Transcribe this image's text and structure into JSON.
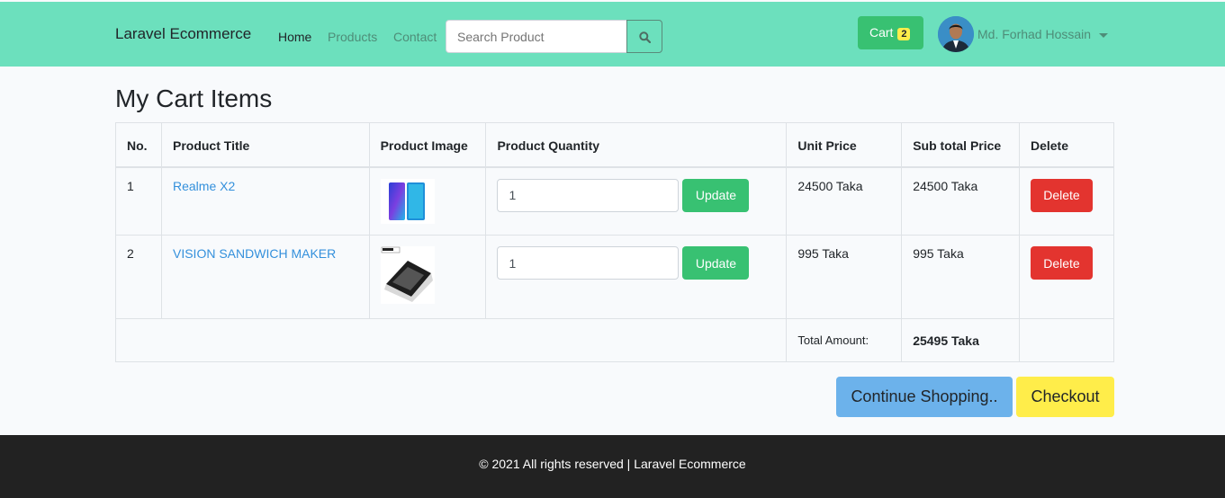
{
  "navbar": {
    "brand": "Laravel Ecommerce",
    "links": [
      "Home",
      "Products",
      "Contact"
    ],
    "search_placeholder": "Search Product",
    "cart_label": "Cart",
    "cart_count": "2",
    "user_name": "Md. Forhad Hossain"
  },
  "page": {
    "title": "My Cart Items"
  },
  "table": {
    "headers": [
      "No.",
      "Product Title",
      "Product Image",
      "Product Quantity",
      "Unit Price",
      "Sub total Price",
      "Delete"
    ],
    "rows": [
      {
        "no": "1",
        "title": "Realme X2",
        "image": "phone-image",
        "quantity": "1",
        "unit_price": "24500 Taka",
        "subtotal": "24500 Taka"
      },
      {
        "no": "2",
        "title": "VISION SANDWICH MAKER",
        "image": "sandwich-maker-image",
        "quantity": "1",
        "unit_price": "995 Taka",
        "subtotal": "995 Taka"
      }
    ],
    "update_label": "Update",
    "delete_label": "Delete",
    "total_label": "Total Amount:",
    "total_value": "25495 Taka"
  },
  "actions": {
    "continue_label": "Continue Shopping..",
    "checkout_label": "Checkout"
  },
  "footer": {
    "text": "© 2021 All rights reserved | Laravel Ecommerce"
  },
  "colors": {
    "navbar": "#6ce0bd",
    "success": "#38c172",
    "danger": "#e3342f",
    "info": "#6cb2eb",
    "warning": "#ffed4a",
    "footer": "#222222"
  }
}
